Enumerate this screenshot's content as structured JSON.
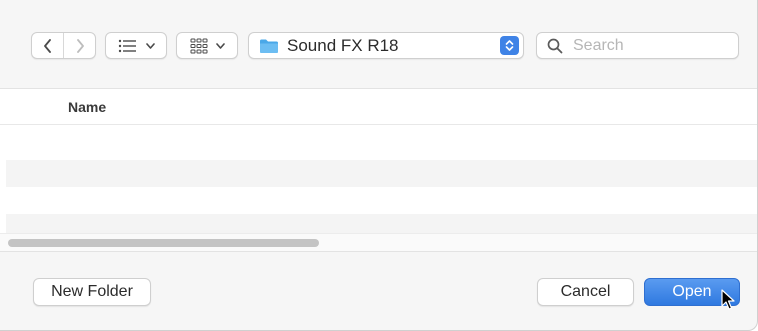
{
  "toolbar": {
    "back_icon": "chevron-left-icon",
    "forward_icon": "chevron-right-icon",
    "view_mode_icon": "list-view-icon",
    "group_icon": "grid-group-icon",
    "location": {
      "label": "Sound FX R18",
      "icon": "folder-icon"
    },
    "search": {
      "placeholder": "Search",
      "value": ""
    }
  },
  "file_list": {
    "columns": [
      "Name"
    ],
    "rows": []
  },
  "footer": {
    "new_folder_label": "New Folder",
    "cancel_label": "Cancel",
    "open_label": "Open"
  },
  "colors": {
    "accent": "#3f83e6",
    "folder": "#4aa8e8"
  }
}
